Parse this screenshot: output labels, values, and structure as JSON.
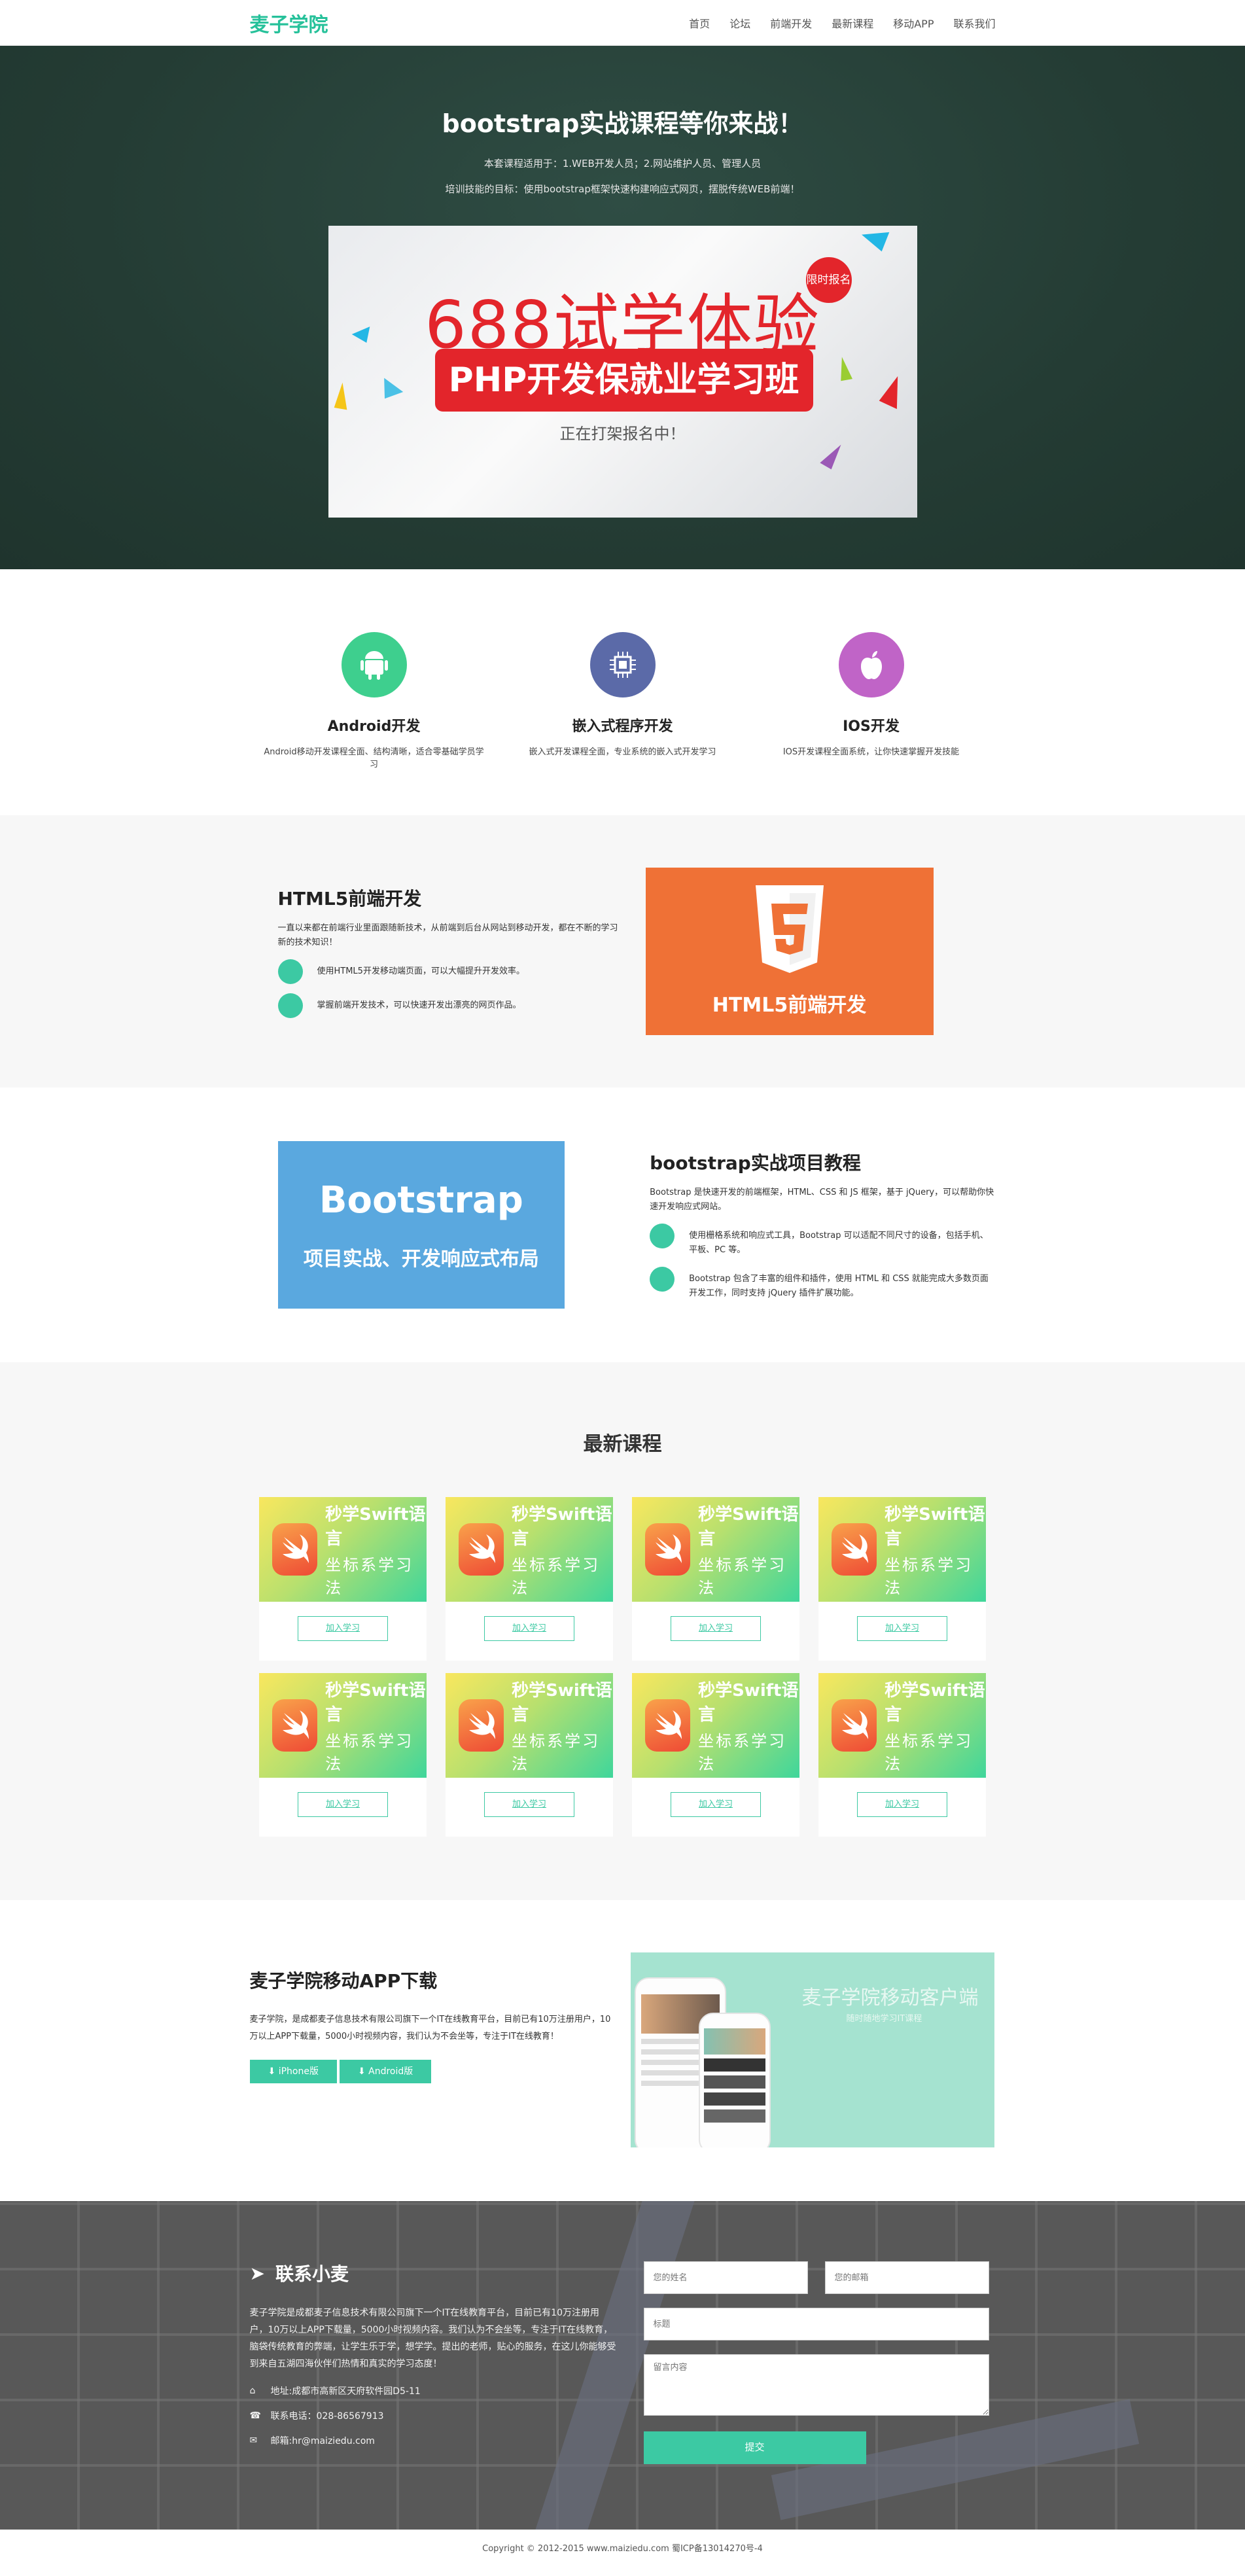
{
  "nav": {
    "brand": "麦子学院",
    "items": [
      "首页",
      "论坛",
      "前端开发",
      "最新课程",
      "移动APP",
      "联系我们"
    ]
  },
  "hero": {
    "title": "bootstrap实战课程等你来战！",
    "line1": "本套课程适用于：1.WEB开发人员；2.网站维护人员、管理人员",
    "line2": "培训技能的目标：使用bootstrap框架快速构建响应式网页，摆脱传统WEB前端！",
    "banner": {
      "big": "688试学体验",
      "bar": "PHP开发保就业学习班",
      "small": "正在打架报名中！",
      "badge": "限时报名"
    }
  },
  "features": [
    {
      "icon": "android-icon",
      "color": "#3ecf8e",
      "title": "Android开发",
      "desc": "Android移动开发课程全面、结构清晰，适合零基础学员学习"
    },
    {
      "icon": "chip-icon",
      "color": "#5b6aa8",
      "title": "嵌入式程序开发",
      "desc": "嵌入式开发课程全面，专业系统的嵌入式开发学习"
    },
    {
      "icon": "apple-icon",
      "color": "#c064c7",
      "title": "IOS开发",
      "desc": "IOS开发课程全面系统，让你快速掌握开发技能"
    }
  ],
  "html5": {
    "title": "HTML5前端开发",
    "lead": "一直以来都在前端行业里面跟随新技术，从前端到后台从网站到移动开发，都在不断的学习新的技术知识！",
    "bullets": [
      "使用HTML5开发移动端页面，可以大幅提升开发效率。",
      "掌握前端开发技术，可以快速开发出漂亮的网页作品。"
    ],
    "image_caption": "HTML5前端开发"
  },
  "bootstrap": {
    "title": "bootstrap实战项目教程",
    "lead": "Bootstrap 是快速开发的前端框架，HTML、CSS 和 JS 框架，基于 jQuery，可以帮助你快速开发响应式网站。",
    "bullets": [
      "使用栅格系统和响应式工具，Bootstrap 可以适配不同尺寸的设备，包括手机、平板、PC 等。",
      "Bootstrap 包含了丰富的组件和插件，使用 HTML 和 CSS 就能完成大多数页面开发工作，同时支持 jQuery 插件扩展功能。"
    ],
    "image_title": "Bootstrap",
    "image_caption": "项目实战、开发响应式布局"
  },
  "courses": {
    "heading": "最新课程",
    "card_line1": "秒学Swift语言",
    "card_line2": "坐标系学习法",
    "join_label": "加入学习",
    "count": 8
  },
  "app": {
    "title": "麦子学院移动APP下载",
    "desc": "麦子学院，是成都麦子信息技术有限公司旗下一个IT在线教育平台，目前已有10万注册用户，10万以上APP下载量，5000小时视频内容，我们认为不会坐等，专注于IT在线教育！",
    "iphone": "iPhone版",
    "android": "Android版",
    "promo_title": "麦子学院移动客户端",
    "promo_sub": "随时随地学习IT课程"
  },
  "contact": {
    "title": "联系小麦",
    "intro": "麦子学院是成都麦子信息技术有限公司旗下一个IT在线教育平台，目前已有10万注册用户，10万以上APP下载量，5000小时视频内容。我们认为不会坐等，专注于IT在线教育，脑袋传统教育的弊端，让学生乐于学，想学学。提出的老师，贴心的服务，在这儿你能够受到来自五湖四海伙伴们热情和真实的学习态度！",
    "address": "地址:成都市高新区天府软件园D5-11",
    "phone": "联系电话：028-86567913",
    "email": "邮箱:hr@maiziedu.com",
    "form": {
      "name_ph": "您的姓名",
      "email_ph": "您的邮箱",
      "subject_ph": "标题",
      "message_ph": "留言内容",
      "submit": "提交"
    }
  },
  "footer": {
    "text": "Copyright © 2012-2015 www.maiziedu.com 蜀ICP备13014270号-4"
  }
}
